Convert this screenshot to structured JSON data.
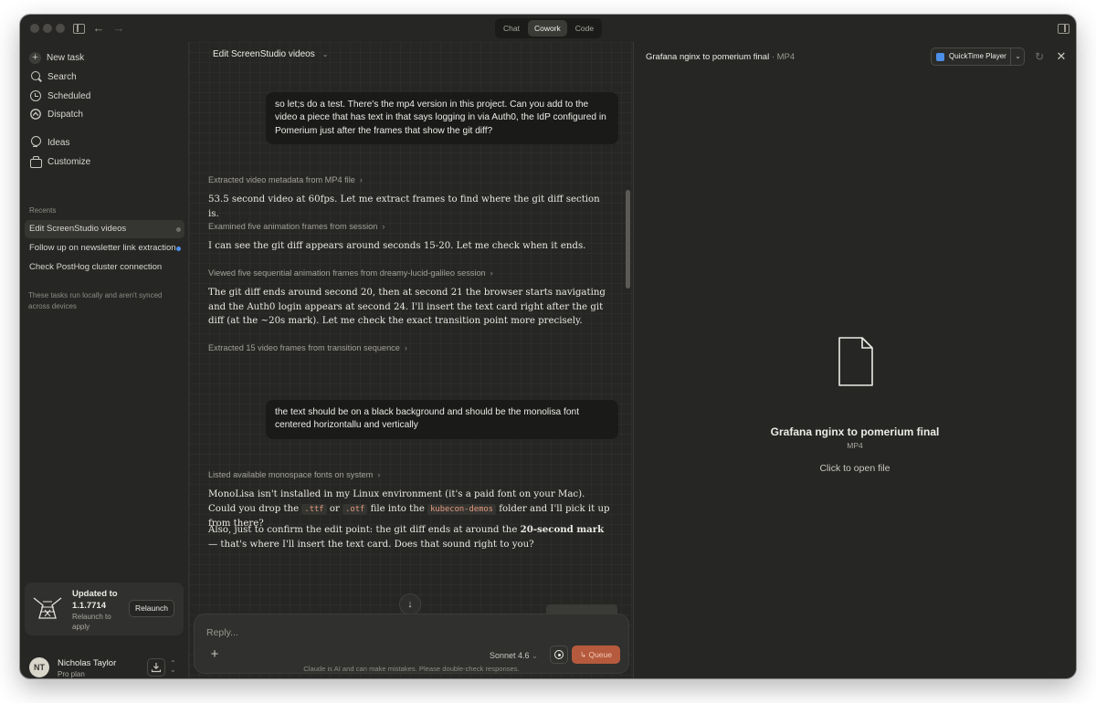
{
  "topbar": {
    "modes": [
      "Chat",
      "Cowork",
      "Code"
    ],
    "active_mode": "Cowork"
  },
  "sidebar": {
    "nav": [
      {
        "label": "New task",
        "icon": "plus-icon"
      },
      {
        "label": "Search",
        "icon": "search-icon"
      },
      {
        "label": "Scheduled",
        "icon": "clock-icon"
      },
      {
        "label": "Dispatch",
        "icon": "dispatch-icon"
      },
      {
        "label": "Ideas",
        "icon": "lightbulb-icon"
      },
      {
        "label": "Customize",
        "icon": "briefcase-icon"
      }
    ],
    "recents_label": "Recents",
    "recents": [
      {
        "label": "Edit ScreenStudio videos",
        "active": true,
        "dot_color": "#6f6e69"
      },
      {
        "label": "Follow up on newsletter link extraction",
        "active": false,
        "dot_color": "#4d8fe8"
      },
      {
        "label": "Check PostHog cluster connection",
        "active": false
      }
    ],
    "sync_note": "These tasks run locally and aren't synced across devices",
    "update": {
      "title": "Updated to 1.1.7714",
      "subtitle": "Relaunch to apply",
      "button": "Relaunch"
    },
    "user": {
      "initials": "NT",
      "name": "Nicholas Taylor",
      "plan": "Pro plan"
    }
  },
  "chat": {
    "title": "Edit ScreenStudio videos",
    "message1": "so let;s do a test. There's the mp4 version in this project. Can you add to the video a piece that has text in that says logging in via Auth0, the IdP configured in Pomerium just after the frames that show the git diff?",
    "step1": "Extracted video metadata from MP4 file",
    "resp1": "53.5 second video at 60fps. Let me extract frames to find where the git diff section is.",
    "step2": "Examined five animation frames from session",
    "resp2": "I can see the git diff appears around seconds 15-20. Let me check when it ends.",
    "step3": "Viewed five sequential animation frames from dreamy-lucid-galileo session",
    "resp3": "The git diff ends around second 20, then at second 21 the browser starts navigating and the Auth0 login appears at second 24. I'll insert the text card right after the git diff (at the ~20s mark). Let me check the exact transition point more precisely.",
    "step4": "Extracted 15 video frames from transition sequence",
    "message2": "the text should be on a black background and should be the monolisa font centered horizontallu and vertically",
    "step5": "Listed available monospace fonts on system",
    "resp5": {
      "p1": "MonoLisa isn't installed in my Linux environment (it's a paid font on your Mac). Could you drop the",
      "code1": ".ttf",
      "or": "or",
      "code2": ".otf",
      "p2": "file into the",
      "code3": "kubecon-demos",
      "p3": "folder and I'll pick it up from there?"
    },
    "resp6": {
      "p1": "Also, just to confirm the edit point: the git diff ends at around the",
      "bold": "20-second mark",
      "p2": "— that's where I'll insert the text card. Does that sound right to you?"
    },
    "composer": {
      "placeholder": "Reply...",
      "model": "Sonnet 4.6",
      "queue_label": "Queue"
    },
    "disclaimer": "Claude is AI and can make mistakes. Please double-check responses."
  },
  "preview": {
    "file_name": "Grafana nginx to pomerium final",
    "file_ext": "MP4",
    "open_with": "QuickTime Player",
    "open_hint": "Click to open file"
  }
}
